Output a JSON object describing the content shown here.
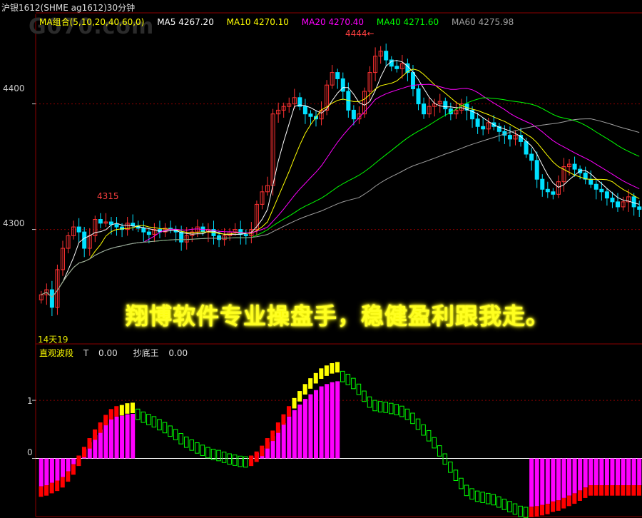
{
  "title": "沪银1612(SHME ag1612)30分钟",
  "watermark": "G070.com",
  "ma_legend": {
    "group": "MA组合(5,10,20,40,60,0)",
    "ma5": "MA5 4267.20",
    "ma10": "MA10 4270.10",
    "ma20": "MA20 4270.40",
    "ma40": "MA40 4271.60",
    "ma60": "MA60 4275.98"
  },
  "price_axis": [
    "4400",
    "4300"
  ],
  "annotations": {
    "high": "4444←",
    "mid": "4315",
    "low": "14天19"
  },
  "banner": "翔博软件专业操盘手，稳健盈利跟我走。",
  "indicator_legend": {
    "name": "直观波段",
    "t_label": "T",
    "t_value": "0.00",
    "cd_label": "抄底王",
    "cd_value": "0.00"
  },
  "indicator_axis": [
    "1",
    "0"
  ],
  "colors": {
    "up_candle": "#ff3232",
    "down_candle": "#00e0ff",
    "ma5": "#ffffff",
    "ma10": "#ffff00",
    "ma20": "#ff00ff",
    "ma40": "#00ff00",
    "ma60": "#a0a0a0",
    "grid": "#8b0000",
    "bar_magenta": "#ff00ff",
    "bar_red": "#ff0000",
    "bar_yellow": "#ffff00",
    "bar_green": "#00ff00"
  },
  "chart_data": {
    "type": "candlestick",
    "price_ylim": [
      4210,
      4460
    ],
    "closes": [
      4248,
      4252,
      4238,
      4268,
      4285,
      4295,
      4302,
      4298,
      4285,
      4295,
      4308,
      4305,
      4306,
      4304,
      4302,
      4300,
      4305,
      4303,
      4301,
      4298,
      4296,
      4300,
      4298,
      4301,
      4300,
      4298,
      4290,
      4295,
      4298,
      4302,
      4298,
      4300,
      4295,
      4292,
      4295,
      4298,
      4300,
      4296,
      4295,
      4300,
      4320,
      4330,
      4335,
      4392,
      4395,
      4398,
      4400,
      4405,
      4398,
      4392,
      4390,
      4388,
      4395,
      4415,
      4425,
      4420,
      4410,
      4395,
      4388,
      4392,
      4410,
      4425,
      4438,
      4442,
      4435,
      4430,
      4428,
      4432,
      4425,
      4412,
      4400,
      4392,
      4398,
      4400,
      4402,
      4396,
      4392,
      4395,
      4400,
      4395,
      4388,
      4382,
      4380,
      4385,
      4382,
      4378,
      4375,
      4372,
      4375,
      4370,
      4360,
      4355,
      4340,
      4332,
      4330,
      4328,
      4338,
      4350,
      4352,
      4348,
      4345,
      4340,
      4336,
      4332,
      4330,
      4325,
      4322,
      4318,
      4322,
      4326,
      4318,
      4316
    ],
    "indicator_ylim": [
      -1.0,
      1.75
    ],
    "indicator": [
      -0.48,
      -0.46,
      -0.42,
      -0.38,
      -0.32,
      -0.22,
      -0.1,
      0.05,
      0.2,
      0.35,
      0.5,
      0.62,
      0.75,
      0.85,
      0.9,
      0.92,
      0.95,
      0.96,
      0.85,
      0.8,
      0.76,
      0.72,
      0.67,
      0.62,
      0.56,
      0.5,
      0.43,
      0.37,
      0.32,
      0.27,
      0.23,
      0.19,
      0.16,
      0.14,
      0.11,
      0.08,
      0.06,
      0.04,
      0.03,
      0.05,
      0.12,
      0.22,
      0.35,
      0.48,
      0.62,
      0.76,
      0.9,
      1.04,
      1.16,
      1.28,
      1.38,
      1.47,
      1.55,
      1.6,
      1.64,
      1.66,
      1.5,
      1.45,
      1.38,
      1.28,
      1.16,
      1.06,
      1.0,
      0.98,
      0.97,
      0.95,
      0.93,
      0.9,
      0.85,
      0.78,
      0.68,
      0.58,
      0.48,
      0.36,
      0.22,
      0.08,
      -0.06,
      -0.2,
      -0.34,
      -0.46,
      -0.52,
      -0.56,
      -0.58,
      -0.6,
      -0.62,
      -0.66,
      -0.7,
      -0.74,
      -0.78,
      -0.82,
      -0.84,
      -0.83,
      -0.82,
      -0.8,
      -0.78,
      -0.74,
      -0.72,
      -0.68,
      -0.64,
      -0.6,
      -0.55,
      -0.5,
      -0.46,
      -0.46,
      -0.46,
      -0.46,
      -0.46,
      -0.46,
      -0.46,
      -0.46,
      -0.46,
      -0.46
    ]
  }
}
